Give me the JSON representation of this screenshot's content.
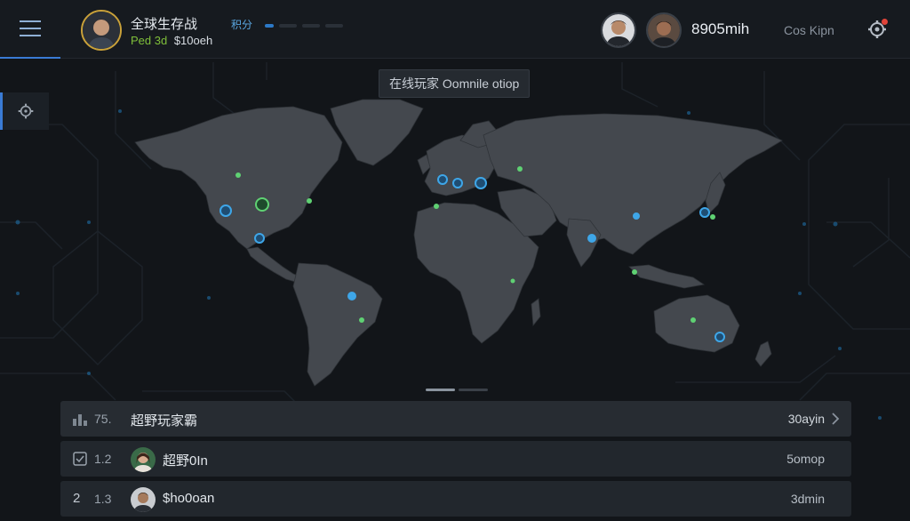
{
  "header": {
    "profile": {
      "name": "全球生存战",
      "level": "Ped 3d",
      "money": "$10oeh"
    },
    "xp_label": "积分",
    "friends": [
      {
        "avatar": "friend-avatar"
      },
      {
        "avatar": "friend-avatar"
      }
    ],
    "currency": "8905mih",
    "account_link": "Cos Kipn"
  },
  "map": {
    "online_badge": "在线玩家 Oomnile otiop"
  },
  "leaderboard": {
    "header": {
      "rank": "75.",
      "title": "超野玩家霸",
      "value": "30ayin"
    },
    "rows": [
      {
        "rank": "1.2",
        "name": "超野0In",
        "value": "5omop"
      },
      {
        "rank": "1.3",
        "name": "$ho0oan",
        "value": "3dmin",
        "icon_text": "2"
      }
    ]
  },
  "colors": {
    "accent": "#3a7bd5",
    "map_land": "#44484e",
    "dot_blue": "#3ea6e8",
    "dot_green": "#5fd173",
    "background": "#121519"
  }
}
